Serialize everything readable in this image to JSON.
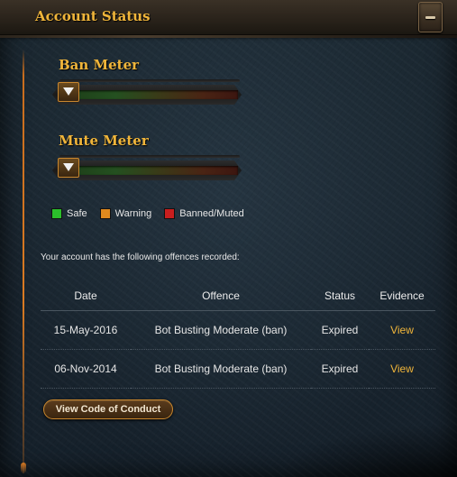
{
  "window": {
    "title": "Account Status",
    "collapse_icon": "minus-icon"
  },
  "meters": {
    "ban": {
      "title": "Ban Meter",
      "level": 0
    },
    "mute": {
      "title": "Mute Meter",
      "level": 0
    }
  },
  "legend": [
    {
      "label": "Safe",
      "color": "#2bbf2b"
    },
    {
      "label": "Warning",
      "color": "#e08a1e"
    },
    {
      "label": "Banned/Muted",
      "color": "#c81e1e"
    }
  ],
  "offences": {
    "intro": "Your account has the following offences recorded:",
    "columns": [
      "Date",
      "Offence",
      "Status",
      "Evidence"
    ],
    "rows": [
      {
        "date": "15-May-2016",
        "offence": "Bot Busting Moderate (ban)",
        "status": "Expired",
        "evidence": "View"
      },
      {
        "date": "06-Nov-2014",
        "offence": "Bot Busting Moderate (ban)",
        "status": "Expired",
        "evidence": "View"
      }
    ]
  },
  "actions": {
    "conduct_label": "View Code of Conduct"
  },
  "colors": {
    "accent": "#f0b53a",
    "timeline": "#d97a22"
  }
}
